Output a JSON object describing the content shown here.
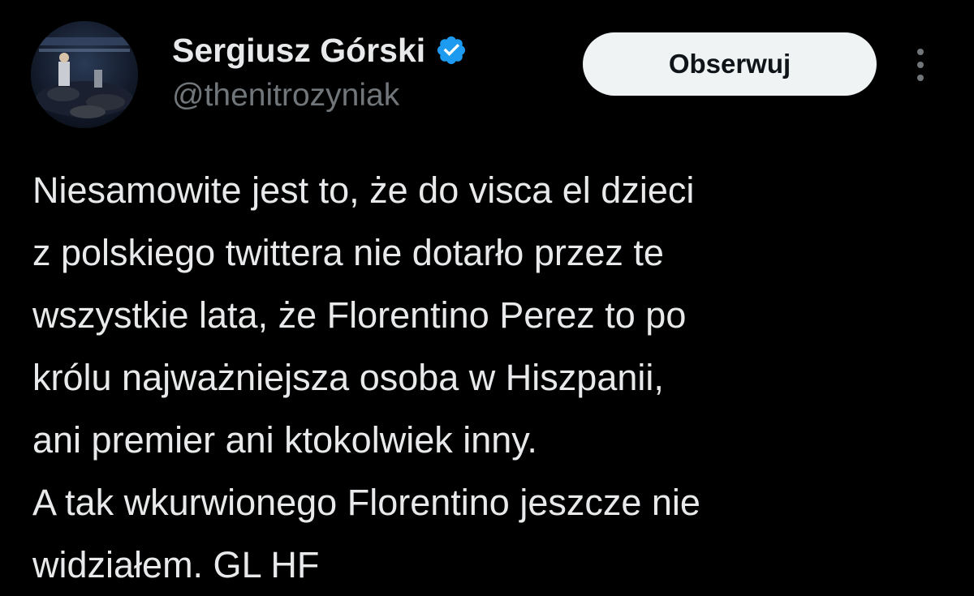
{
  "author": {
    "display_name": "Sergiusz Górski",
    "handle": "@thenitrozyniak",
    "verified_icon": "verified-badge-icon",
    "avatar_icon": "profile-avatar"
  },
  "follow_button": {
    "label": "Obserwuj"
  },
  "more_menu": {
    "icon": "more-vertical-icon"
  },
  "tweet": {
    "lines": [
      "Niesamowite jest to, że do visca el dzieci",
      "z polskiego twittera nie dotarło przez te",
      "wszystkie lata, że Florentino Perez to po",
      "królu najważniejsza osoba w Hiszpanii,",
      "ani premier ani ktokolwiek inny.",
      "A tak wkurwionego Florentino jeszcze nie",
      "widziałem. GL HF"
    ]
  },
  "colors": {
    "background": "#000000",
    "text_primary": "#e7e9ea",
    "text_secondary": "#71767b",
    "verified_blue": "#1d9bf0",
    "button_bg": "#eff3f4",
    "button_text": "#0f1419"
  }
}
